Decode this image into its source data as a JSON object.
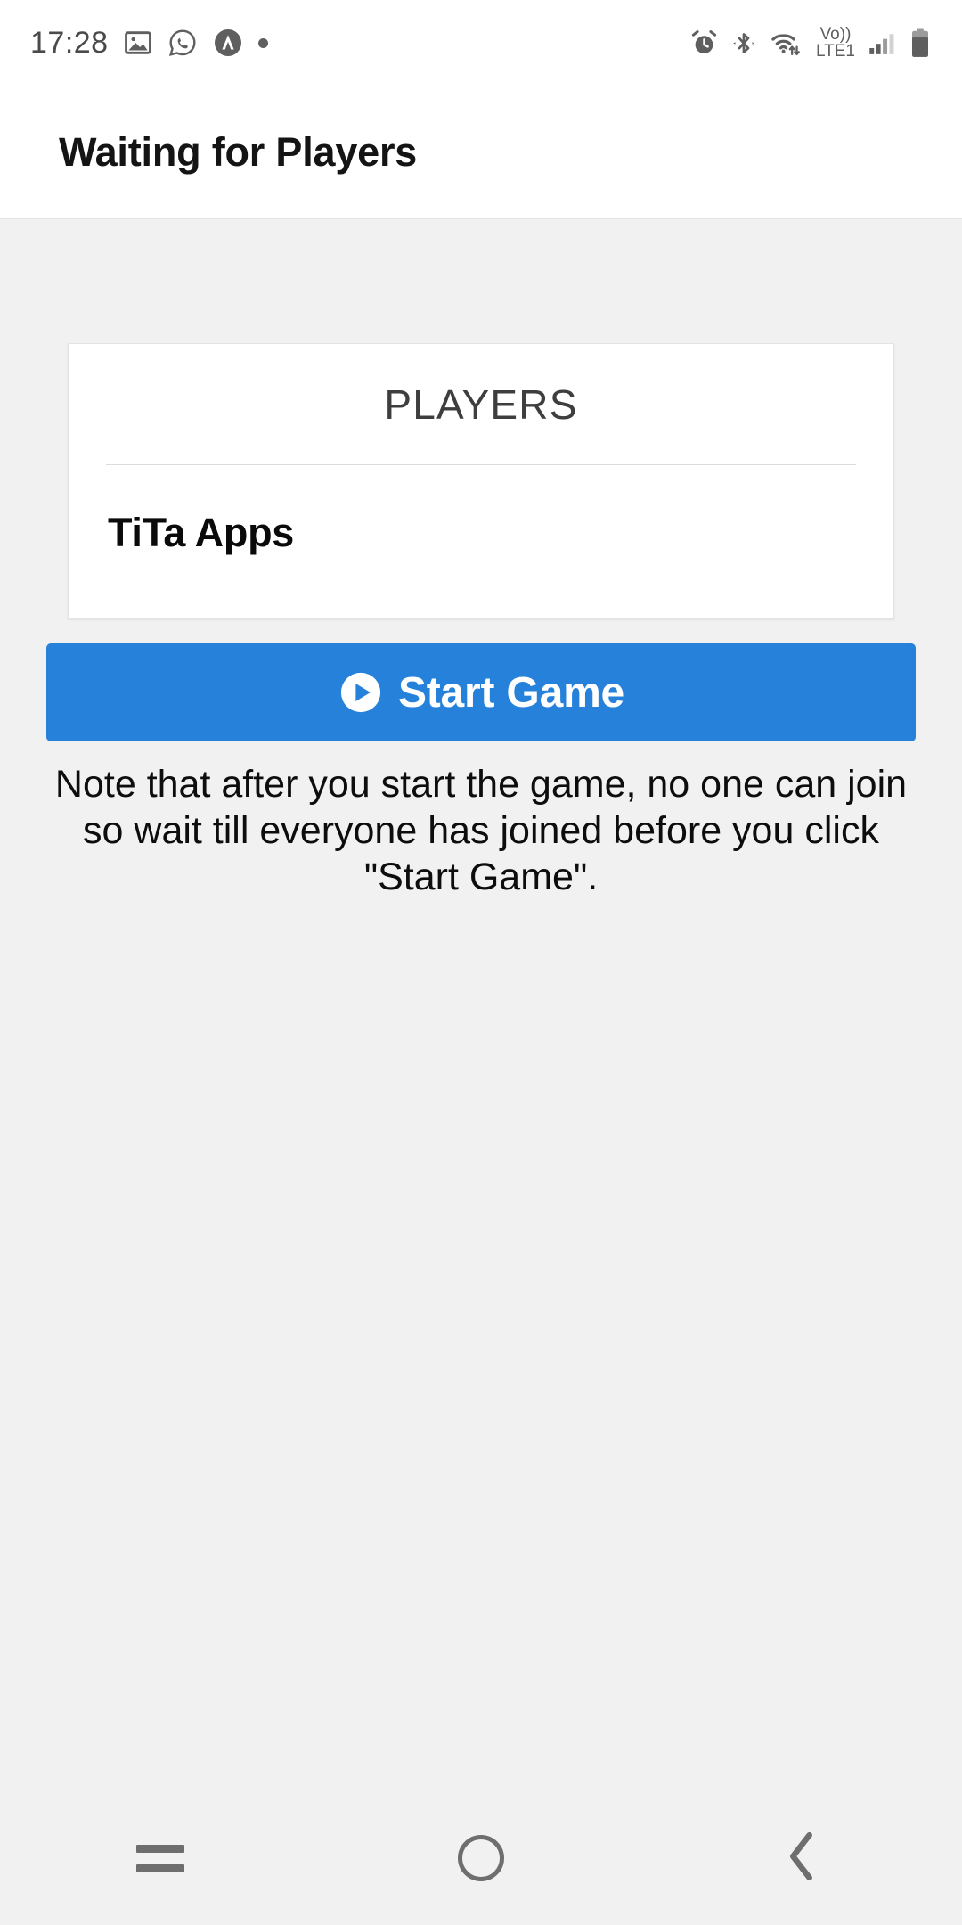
{
  "statusbar": {
    "time": "17:28",
    "left_icons": [
      "photos-icon",
      "whatsapp-icon",
      "app-badge-icon",
      "dot-icon"
    ],
    "right_icons": [
      "alarm-icon",
      "bluetooth-icon",
      "wifi-icon",
      "volte-icon",
      "signal-icon",
      "battery-icon"
    ],
    "volte_label_top": "Vo))",
    "volte_label_bottom": "LTE1"
  },
  "appbar": {
    "title": "Waiting for Players"
  },
  "players_card": {
    "header": "PLAYERS",
    "players": [
      {
        "name": "TiTa Apps"
      }
    ]
  },
  "start_button": {
    "label": "Start Game",
    "icon": "play-circle-icon",
    "color": "#2581da",
    "text_color": "#ffffff"
  },
  "note": {
    "text": "Note that after you start the game, no one can join so wait till everyone has joined before you click \"Start Game\"."
  },
  "navbar": {
    "recents_label": "recents-icon",
    "home_label": "home-icon",
    "back_label": "back-icon"
  },
  "colors": {
    "page_background": "#f1f1f1",
    "surface": "#ffffff",
    "accent": "#2581da",
    "text_primary": "#0a0a0a",
    "text_secondary": "#3e3e3e",
    "divider": "#dcdcdc"
  }
}
